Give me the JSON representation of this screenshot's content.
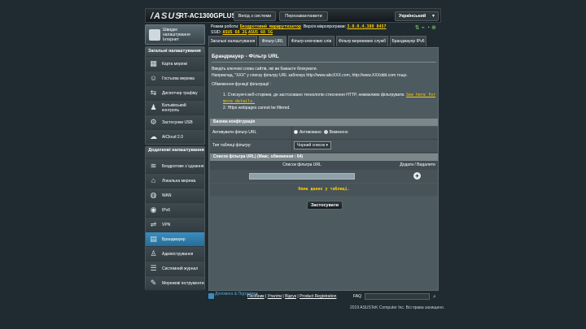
{
  "header": {
    "logo": "/ASUS",
    "model": "RT-AC1300GPLUS",
    "logout_label": "Вихід з системи",
    "reboot_label": "Перезавантажити",
    "language": "Український"
  },
  "status": {
    "mode_label": "Режим роботи:",
    "mode_value": "Бездротовий маршрутизатор",
    "firmware_label": "Версія мікропрограми:",
    "firmware_value": "3.0.0.4.380_8457",
    "ssid_label": "SSID:",
    "ssid_values": [
      "ASUS_68_2G",
      "ASUS_68_5G"
    ],
    "icons": [
      "network-status-icon",
      "usb-icon",
      "wifi-icon",
      "settings-icon"
    ]
  },
  "sidebar": {
    "quick_setup": "Швидке налаштування Інтернет",
    "general_title": "Загальні налаштування",
    "general_items": [
      {
        "label": "Карта мережі",
        "icon": "network-map-icon"
      },
      {
        "label": "Гостьова мережа",
        "icon": "guest-network-icon"
      },
      {
        "label": "Диспетчер трафіку",
        "icon": "traffic-manager-icon"
      },
      {
        "label": "Батьківський контроль",
        "icon": "parental-control-icon"
      },
      {
        "label": "Застосунки USB",
        "icon": "usb-app-icon"
      },
      {
        "label": "AiCloud 2.0",
        "icon": "cloud-icon"
      }
    ],
    "advanced_title": "Додаткові налаштування",
    "advanced_items": [
      {
        "label": "Бездротове з`єднання",
        "icon": "wireless-icon"
      },
      {
        "label": "Локальна мережа",
        "icon": "lan-icon"
      },
      {
        "label": "WAN",
        "icon": "globe-icon"
      },
      {
        "label": "IPv6",
        "icon": "ipv6-icon"
      },
      {
        "label": "VPN",
        "icon": "vpn-icon"
      },
      {
        "label": "Брандмауер",
        "icon": "firewall-icon",
        "active": true
      },
      {
        "label": "Адміністрування",
        "icon": "admin-icon"
      },
      {
        "label": "Системний журнал",
        "icon": "system-log-icon"
      },
      {
        "label": "Мережеві інструменти",
        "icon": "network-tools-icon"
      }
    ]
  },
  "tabs": [
    {
      "label": "Загальні налаштування",
      "active": false
    },
    {
      "label": "Фільтр URL",
      "active": true
    },
    {
      "label": "Фільтр ключових слів",
      "active": false
    },
    {
      "label": "Фільтр мережевих служб",
      "active": false
    },
    {
      "label": "Брандмауер IPv6",
      "active": false
    }
  ],
  "panel": {
    "title": "Брандмауер - Фільтр URL",
    "desc1": "Введіть ключові слова сайтів, які ви бажаєте блокувати.",
    "desc2": "Наприклад, \"XXX\" у списку фільтру URL заблокує http://www.abcXXX.com, http://www.XXXddd.com тощо.",
    "limits_title": "Обмеження функції фільтрації :",
    "limit1": "Стискуючі веб-сторінки, де застосовано технологію стиснення HTTP, неможливо фільтрувати.",
    "limit1_link": "See here for more details.",
    "limit2": "Https webpages cannot be filtered.",
    "basic_title": "Базова конфігурація",
    "enable_label": "Активувати фільтр URL",
    "enable_on": "Активовано",
    "enable_off": "Вимкнено",
    "type_label": "Тип таблиці фільтру:",
    "type_value": "Чорний список",
    "list_title": "Список фільтра URL) (Макс. обмеження : 64)",
    "col_url": "Список фільтра URL",
    "col_action": "Додати / Видалити",
    "empty_text": "Нема даних у таблиці.",
    "apply_label": "Застосувати"
  },
  "footer": {
    "help": "Допомога & Підтримка",
    "links": [
      "Посібник",
      "Утиліти",
      "Відгук",
      "Product Registration"
    ],
    "faq": "FAQ"
  },
  "copyright": "2019 ASUSTeK Computer Inc. Всі права захищено."
}
